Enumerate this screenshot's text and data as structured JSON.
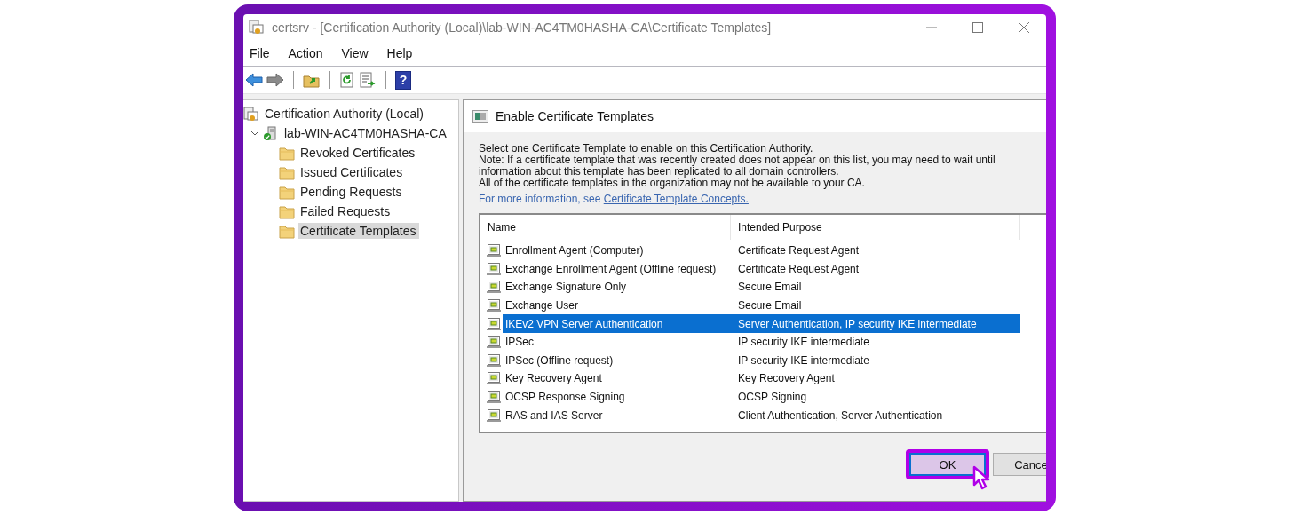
{
  "window": {
    "title": "certsrv - [Certification Authority (Local)\\lab-WIN-AC4TM0HASHA-CA\\Certificate Templates]"
  },
  "menu": [
    "File",
    "Action",
    "View",
    "Help"
  ],
  "toolbar": {
    "help_glyph": "?"
  },
  "tree": [
    {
      "label": "Certification Authority (Local)",
      "kind": "root",
      "selected": false,
      "children": [
        {
          "label": "lab-WIN-AC4TM0HASHA-CA",
          "kind": "server",
          "selected": false,
          "expanded": true,
          "children": [
            {
              "label": "Revoked Certificates",
              "kind": "folder",
              "selected": false
            },
            {
              "label": "Issued Certificates",
              "kind": "folder",
              "selected": false
            },
            {
              "label": "Pending Requests",
              "kind": "folder",
              "selected": false
            },
            {
              "label": "Failed Requests",
              "kind": "folder",
              "selected": false
            },
            {
              "label": "Certificate Templates",
              "kind": "folder",
              "selected": true
            }
          ]
        }
      ]
    }
  ],
  "dialog": {
    "title": "Enable Certificate Templates",
    "description": [
      "Select one Certificate Template to enable on this Certification Authority.",
      "Note: If a certificate template that was recently created does not appear on this list, you may need to wait until",
      "information about this template has been replicated to all domain controllers.",
      "All of the certificate templates in the organization may not be available to your CA."
    ],
    "more_info": {
      "text": "For more information, see ",
      "link": "Certificate Template Concepts."
    },
    "table": {
      "columns": [
        "Name",
        "Intended Purpose"
      ],
      "rows": [
        {
          "name": "Enrollment Agent (Computer)",
          "purpose": "Certificate Request Agent",
          "selected": false
        },
        {
          "name": "Exchange Enrollment Agent (Offline request)",
          "purpose": "Certificate Request Agent",
          "selected": false
        },
        {
          "name": "Exchange Signature Only",
          "purpose": "Secure Email",
          "selected": false
        },
        {
          "name": "Exchange User",
          "purpose": "Secure Email",
          "selected": false
        },
        {
          "name": "IKEv2 VPN Server Authentication",
          "purpose": "Server Authentication, IP security IKE intermediate",
          "selected": true
        },
        {
          "name": "IPSec",
          "purpose": "IP security IKE intermediate",
          "selected": false
        },
        {
          "name": "IPSec (Offline request)",
          "purpose": "IP security IKE intermediate",
          "selected": false
        },
        {
          "name": "Key Recovery Agent",
          "purpose": "Key Recovery Agent",
          "selected": false
        },
        {
          "name": "OCSP Response Signing",
          "purpose": "OCSP Signing",
          "selected": false
        },
        {
          "name": "RAS and IAS Server",
          "purpose": "Client Authentication, Server Authentication",
          "selected": false
        }
      ]
    },
    "buttons": [
      {
        "label": "OK",
        "highlighted": true
      },
      {
        "label": "Cance",
        "highlighted": false
      }
    ]
  }
}
